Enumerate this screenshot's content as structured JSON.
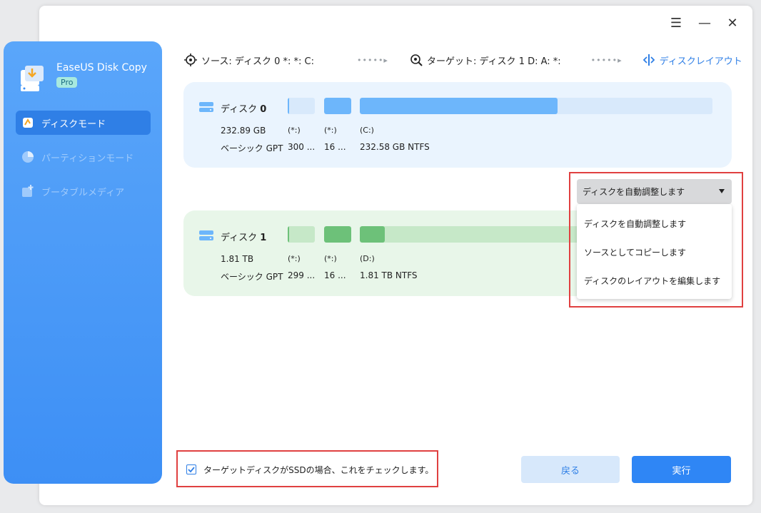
{
  "app": {
    "name": "EaseUS Disk Copy",
    "edition": "Pro"
  },
  "window_controls": {
    "menu": "☰",
    "minimize": "—",
    "close": "✕"
  },
  "nav": [
    {
      "label": "ディスクモード",
      "state": "active"
    },
    {
      "label": "パーティションモード",
      "state": "disabled"
    },
    {
      "label": "ブータブルメディア",
      "state": "disabled"
    }
  ],
  "steps": {
    "source": "ソース: ディスク 0 *: *: C:",
    "target": "ターゲット: ディスク 1 D: A: *:",
    "layout": "ディスクレイアウト",
    "dots": "•••••▸"
  },
  "source_disk": {
    "name_prefix": "ディスク ",
    "name_num": "0",
    "size": "232.89 GB",
    "type": "ベーシック GPT",
    "partitions": [
      {
        "label": "(*:)",
        "info": "300 ...",
        "usage": 0.05
      },
      {
        "label": "(*:)",
        "info": "16 ...",
        "usage": 1.0
      },
      {
        "label": "(C:)",
        "info": "232.58 GB NTFS",
        "usage": 0.56
      }
    ]
  },
  "target_disk": {
    "name_prefix": "ディスク ",
    "name_num": "1",
    "size": "1.81 TB",
    "type": "ベーシック GPT",
    "partitions": [
      {
        "label": "(*:)",
        "info": "299 ...",
        "usage": 0.05
      },
      {
        "label": "(*:)",
        "info": "16 ...",
        "usage": 1.0
      },
      {
        "label": "(D:)",
        "info": "1.81 TB NTFS",
        "usage": 0.07
      }
    ]
  },
  "layout_dropdown": {
    "selected": "ディスクを自動調整します",
    "options": [
      "ディスクを自動調整します",
      "ソースとしてコピーします",
      "ディスクのレイアウトを編集します"
    ]
  },
  "ssd_checkbox": {
    "label": "ターゲットディスクがSSDの場合、これをチェックします。",
    "checked": true
  },
  "buttons": {
    "back": "戻る",
    "run": "実行"
  },
  "colors": {
    "sidebar": "#4a9af8",
    "accent": "#2f86f5",
    "source_bar": "#6db6fb",
    "source_track": "#d8e9fb",
    "target_bar": "#6dc179",
    "target_track": "#c6e8c8",
    "highlight_border": "#e04040"
  }
}
